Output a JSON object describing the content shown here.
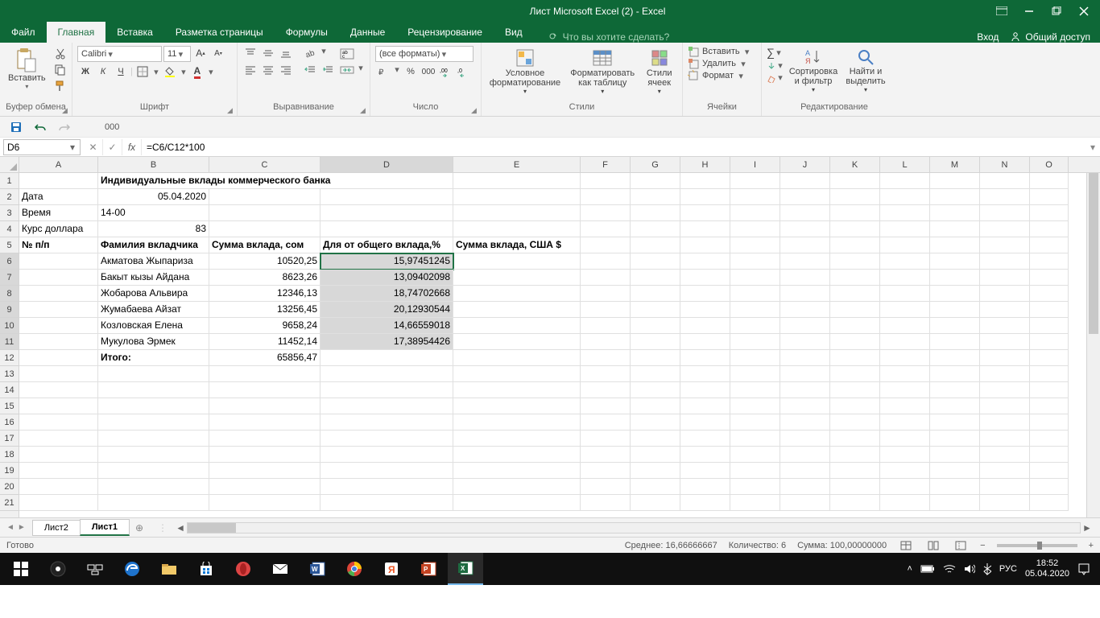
{
  "title": "Лист Microsoft Excel (2) - Excel",
  "menu": {
    "file": "Файл",
    "tabs": [
      "Главная",
      "Вставка",
      "Разметка страницы",
      "Формулы",
      "Данные",
      "Рецензирование",
      "Вид"
    ],
    "active_tab": "Главная",
    "search_placeholder": "Что вы хотите сделать?",
    "login": "Вход",
    "share": "Общий доступ"
  },
  "ribbon": {
    "clipboard": {
      "paste": "Вставить",
      "label": "Буфер обмена"
    },
    "font": {
      "name": "Calibri",
      "size": "11",
      "label": "Шрифт",
      "bold": "Ж",
      "italic": "К",
      "underline": "Ч"
    },
    "alignment": {
      "label": "Выравнивание"
    },
    "number": {
      "format": "(все форматы)",
      "label": "Число"
    },
    "styles": {
      "cond": "Условное форматирование",
      "table": "Форматировать как таблицу",
      "cell": "Стили ячеек",
      "label": "Стили"
    },
    "cells": {
      "insert": "Вставить",
      "delete": "Удалить",
      "format": "Формат",
      "label": "Ячейки"
    },
    "editing": {
      "sort": "Сортировка и фильтр",
      "find": "Найти и выделить",
      "label": "Редактирование"
    }
  },
  "qat_display": "000",
  "namebox": "D6",
  "formula": "=C6/C12*100",
  "cols": [
    {
      "l": "A",
      "w": 98
    },
    {
      "l": "B",
      "w": 138
    },
    {
      "l": "C",
      "w": 138
    },
    {
      "l": "D",
      "w": 165
    },
    {
      "l": "E",
      "w": 158
    },
    {
      "l": "F",
      "w": 62
    },
    {
      "l": "G",
      "w": 62
    },
    {
      "l": "H",
      "w": 62
    },
    {
      "l": "I",
      "w": 62
    },
    {
      "l": "J",
      "w": 62
    },
    {
      "l": "K",
      "w": 62
    },
    {
      "l": "L",
      "w": 62
    },
    {
      "l": "M",
      "w": 62
    },
    {
      "l": "N",
      "w": 62
    },
    {
      "l": "O",
      "w": 48
    }
  ],
  "row_count": 21,
  "sheet": {
    "title_row": "Индивидуальные вклады коммерческого банка",
    "date_label": "Дата",
    "date_val": "05.04.2020",
    "time_label": "Время",
    "time_val": "14-00",
    "rate_label": "Курс доллара",
    "rate_val": "83",
    "hdr": {
      "a": "№ п/п",
      "b": "Фамилия вкладчика",
      "c": "Сумма вклада, сом",
      "d": "Для от общего вклада,%",
      "e": "Сумма вклада, США $"
    },
    "rows": [
      {
        "b": "Акматова Жыпариза",
        "c": "10520,25",
        "d": "15,97451245"
      },
      {
        "b": "Бакыт кызы Айдана",
        "c": "8623,26",
        "d": "13,09402098"
      },
      {
        "b": "Жобарова Альвира",
        "c": "12346,13",
        "d": "18,74702668"
      },
      {
        "b": "Жумабаева Айзат",
        "c": "13256,45",
        "d": "20,12930544"
      },
      {
        "b": "Козловская Елена",
        "c": "9658,24",
        "d": "14,66559018"
      },
      {
        "b": "Мукулова Эрмек",
        "c": "11452,14",
        "d": "17,38954426"
      }
    ],
    "total_label": "Итого:",
    "total_val": "65856,47"
  },
  "tabs": {
    "sheet2": "Лист2",
    "sheet1": "Лист1"
  },
  "statusbar": {
    "ready": "Готово",
    "avg_label": "Среднее:",
    "avg": "16,66666667",
    "count_label": "Количество:",
    "count": "6",
    "sum_label": "Сумма:",
    "sum": "100,00000000",
    "zoom": ""
  },
  "taskbar": {
    "lang": "РУС",
    "time": "18:52",
    "date": "05.04.2020"
  }
}
